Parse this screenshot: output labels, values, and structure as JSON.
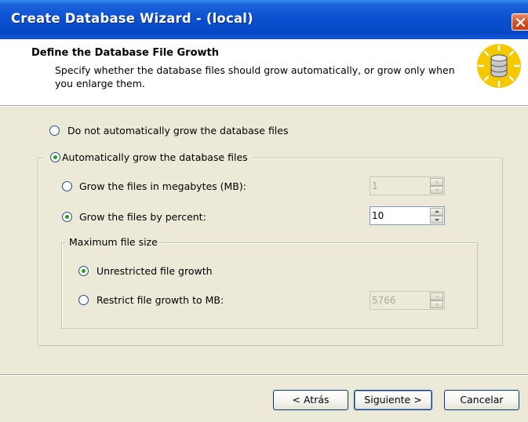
{
  "window": {
    "title": "Create Database Wizard - (local)"
  },
  "header": {
    "title": "Define the Database File Growth",
    "subtitle": "Specify whether the database files should grow automatically, or grow only when you enlarge them.",
    "icon": "database-icon"
  },
  "growth": {
    "no_grow_label": "Do not automatically grow the database files",
    "no_grow_checked": false,
    "auto_grow_label": "Automatically grow the database files",
    "auto_grow_checked": true,
    "megabytes_label": "Grow the files in megabytes (MB):",
    "megabytes_checked": false,
    "megabytes_value": "1",
    "percent_label": "Grow the files by percent:",
    "percent_checked": true,
    "percent_value": "10"
  },
  "max_size": {
    "caption": "Maximum file size",
    "unrestricted_label": "Unrestricted file growth",
    "unrestricted_checked": true,
    "restrict_label": "Restrict file growth to MB:",
    "restrict_checked": false,
    "restrict_value": "5766"
  },
  "buttons": {
    "back": "< Atrás",
    "next": "Siguiente >",
    "cancel": "Cancelar"
  },
  "colors": {
    "title_bar": "#0A50D0",
    "dialog_bg": "#ECE9D8",
    "radio_dot": "#21A121",
    "close_button": "#D5532B"
  }
}
